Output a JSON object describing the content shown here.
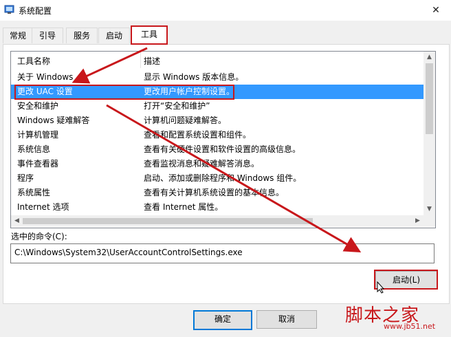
{
  "window": {
    "title": "系统配置",
    "close_glyph": "✕",
    "icon": "msconfig-icon"
  },
  "tabs": [
    {
      "label": "常规",
      "active": false
    },
    {
      "label": "引导",
      "active": false
    },
    {
      "label": "服务",
      "active": false
    },
    {
      "label": "启动",
      "active": false
    },
    {
      "label": "工具",
      "active": true
    }
  ],
  "tools_list": {
    "columns": [
      "工具名称",
      "描述"
    ],
    "selected_index": 1,
    "rows": [
      {
        "name": "关于 Windows",
        "desc": "显示 Windows 版本信息。"
      },
      {
        "name": "更改 UAC 设置",
        "desc": "更改用户帐户控制设置。"
      },
      {
        "name": "安全和维护",
        "desc": "打开“安全和维护”"
      },
      {
        "name": "Windows 疑难解答",
        "desc": "计算机问题疑难解答。"
      },
      {
        "name": "计算机管理",
        "desc": "查看和配置系统设置和组件。"
      },
      {
        "name": "系统信息",
        "desc": "查看有关硬件设置和软件设置的高级信息。"
      },
      {
        "name": "事件查看器",
        "desc": "查看监视消息和疑难解答消息。"
      },
      {
        "name": "程序",
        "desc": "启动、添加或删除程序和 Windows 组件。"
      },
      {
        "name": "系统属性",
        "desc": "查看有关计算机系统设置的基本信息。"
      },
      {
        "name": "Internet 选项",
        "desc": "查看 Internet 属性。"
      }
    ]
  },
  "command": {
    "label": "选中的命令(C):",
    "value": "C:\\Windows\\System32\\UserAccountControlSettings.exe"
  },
  "buttons": {
    "launch": "启动(L)",
    "ok": "确定",
    "cancel": "取消"
  },
  "watermark": {
    "text": "脚本之家",
    "url": "www.jb51.net"
  },
  "colors": {
    "selection": "#3399ff",
    "annotation": "#c8171b",
    "default_button_border": "#0078d7"
  }
}
